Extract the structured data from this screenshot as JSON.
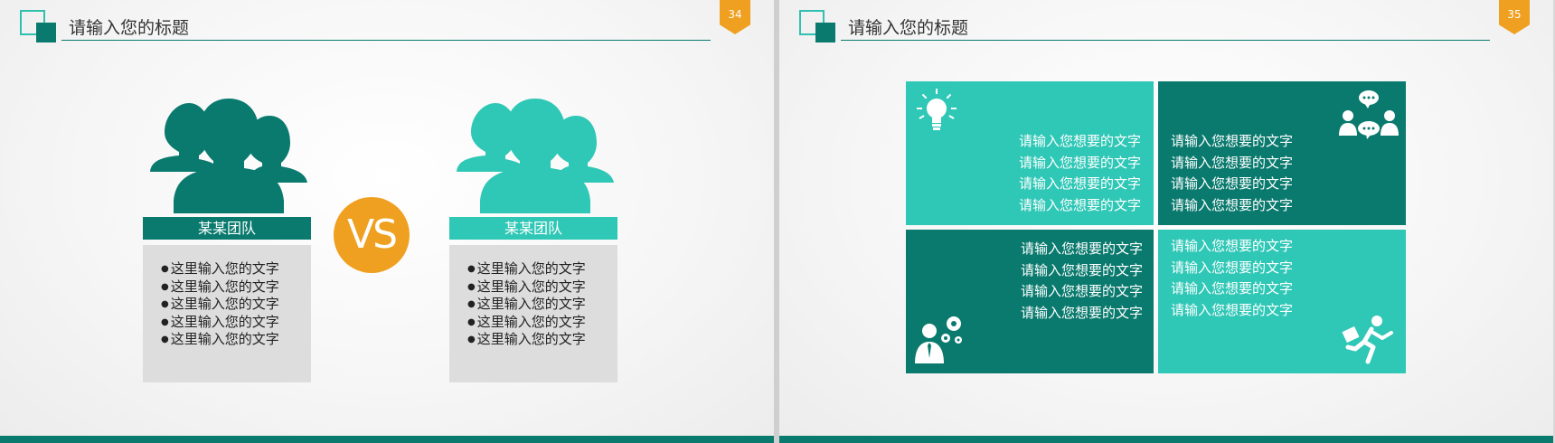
{
  "colors": {
    "dark_teal": "#0a7a6e",
    "light_teal": "#2fc7b6",
    "orange": "#f0a020",
    "list_bg": "#dddddd"
  },
  "slide34": {
    "title": "请输入您的标题",
    "page_number": "34",
    "vs": "VS",
    "team_left": {
      "label": "某某团队",
      "items": [
        "这里输入您的文字",
        "这里输入您的文字",
        "这里输入您的文字",
        "这里输入您的文字",
        "这里输入您的文字"
      ]
    },
    "team_right": {
      "label": "某某团队",
      "items": [
        "这里输入您的文字",
        "这里输入您的文字",
        "这里输入您的文字",
        "这里输入您的文字",
        "这里输入您的文字"
      ]
    },
    "icons": [
      "team-icon",
      "team-icon"
    ]
  },
  "slide35": {
    "title": "请输入您的标题",
    "page_number": "35",
    "cells": [
      {
        "icon": "lightbulb-icon",
        "lines": [
          "请输入您想要的文字",
          "请输入您想要的文字",
          "请输入您想要的文字",
          "请输入您想要的文字"
        ]
      },
      {
        "icon": "discussion-icon",
        "lines": [
          "请输入您想要的文字",
          "请输入您想要的文字",
          "请输入您想要的文字",
          "请输入您想要的文字"
        ]
      },
      {
        "icon": "businessman-gears-icon",
        "lines": [
          "请输入您想要的文字",
          "请输入您想要的文字",
          "请输入您想要的文字",
          "请输入您想要的文字"
        ]
      },
      {
        "icon": "running-man-icon",
        "lines": [
          "请输入您想要的文字",
          "请输入您想要的文字",
          "请输入您想要的文字",
          "请输入您想要的文字"
        ]
      }
    ]
  }
}
